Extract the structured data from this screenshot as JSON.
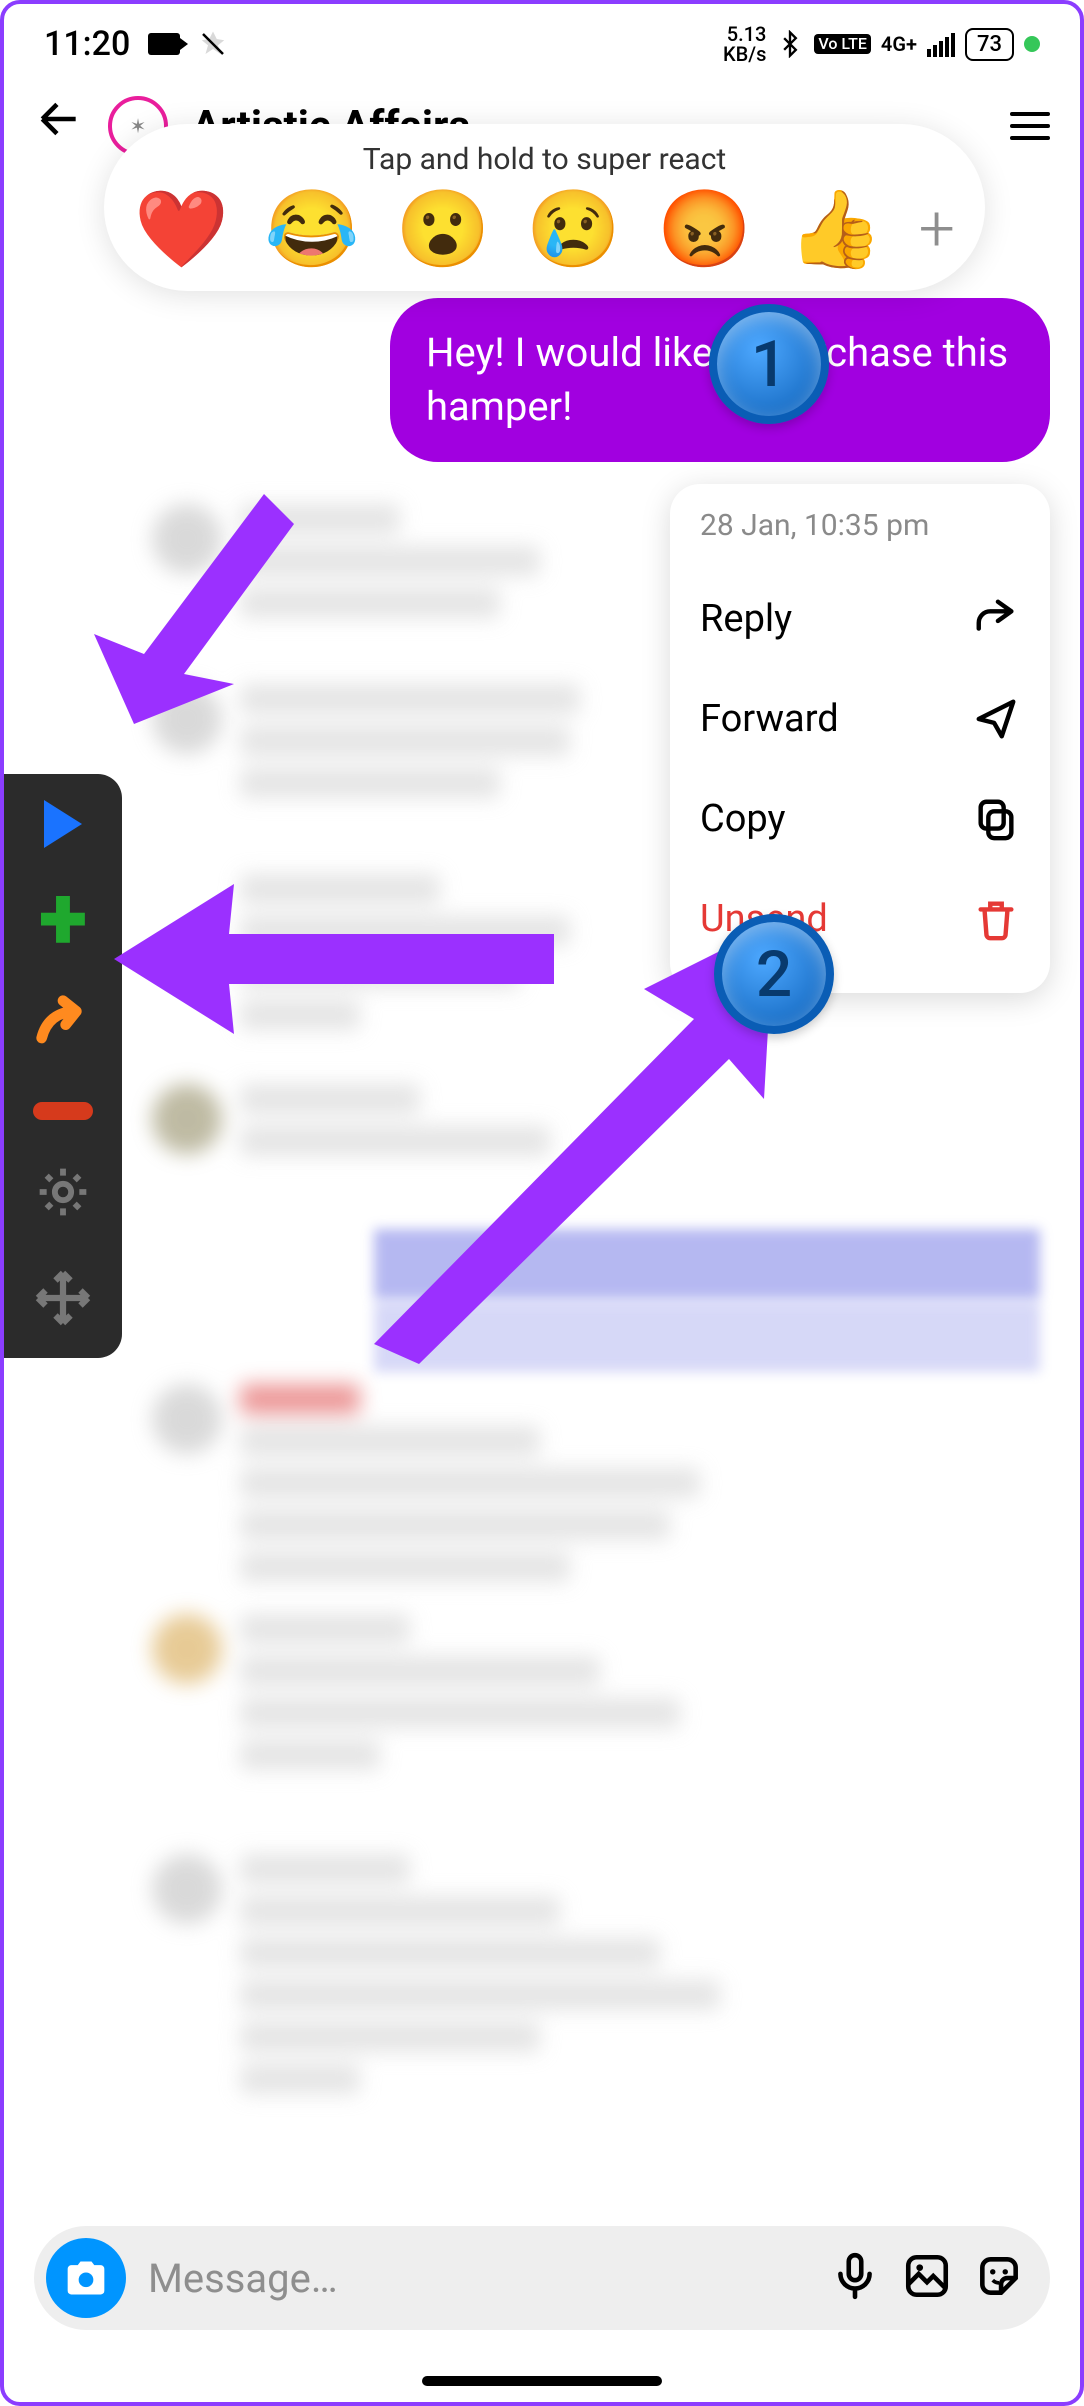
{
  "status": {
    "time": "11:20",
    "net_speed_top": "5.13",
    "net_speed_bottom": "KB/s",
    "volte": "Vo LTE",
    "signal_label": "4G+",
    "battery": "73"
  },
  "header": {
    "contact_name": "Artistic Affairs"
  },
  "reaction_bar": {
    "hint": "Tap and hold to super react",
    "emojis": [
      "❤️",
      "😂",
      "😮",
      "😢",
      "😡",
      "👍"
    ],
    "add": "+"
  },
  "message": {
    "text": "Hey! I would like to purchase this hamper!"
  },
  "context_menu": {
    "timestamp": "28 Jan, 10:35 pm",
    "items": [
      {
        "label": "Reply",
        "icon": "reply",
        "danger": false
      },
      {
        "label": "Forward",
        "icon": "send",
        "danger": false
      },
      {
        "label": "Copy",
        "icon": "copy",
        "danger": false
      },
      {
        "label": "Unsend",
        "icon": "trash",
        "danger": true
      }
    ]
  },
  "steps": {
    "one": "1",
    "two": "2"
  },
  "input": {
    "placeholder": "Message…"
  }
}
